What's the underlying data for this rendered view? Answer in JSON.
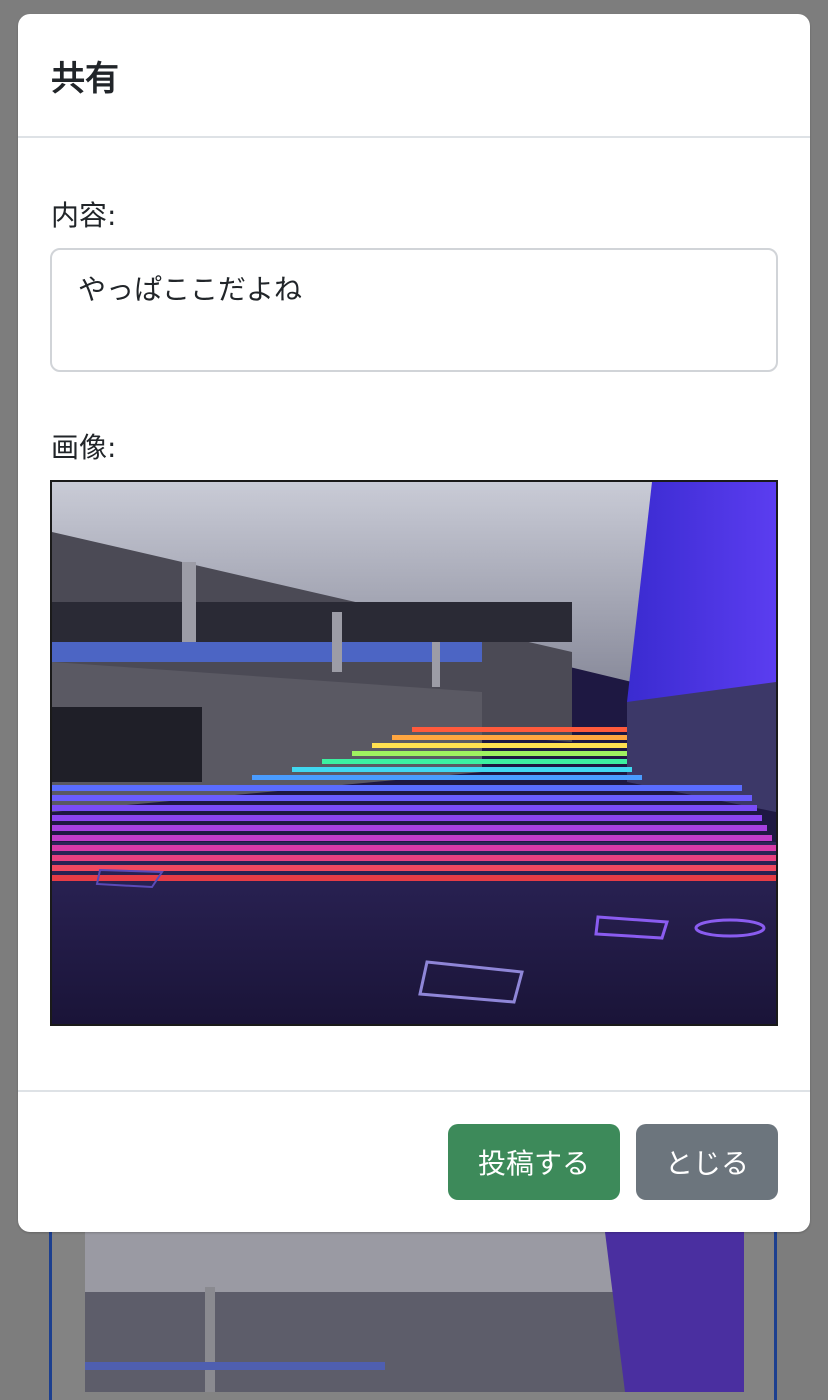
{
  "modal": {
    "title": "共有",
    "content_label": "内容:",
    "content_value": "やっぱここだよね",
    "image_label": "画像:",
    "post_button": "投稿する",
    "close_button": "とじる"
  },
  "image": {
    "description_icon": "photo-rainbow-staircase"
  },
  "colors": {
    "post_button": "#3d8a5a",
    "close_button": "#6c757d",
    "overlay": "#7d7d7d"
  }
}
